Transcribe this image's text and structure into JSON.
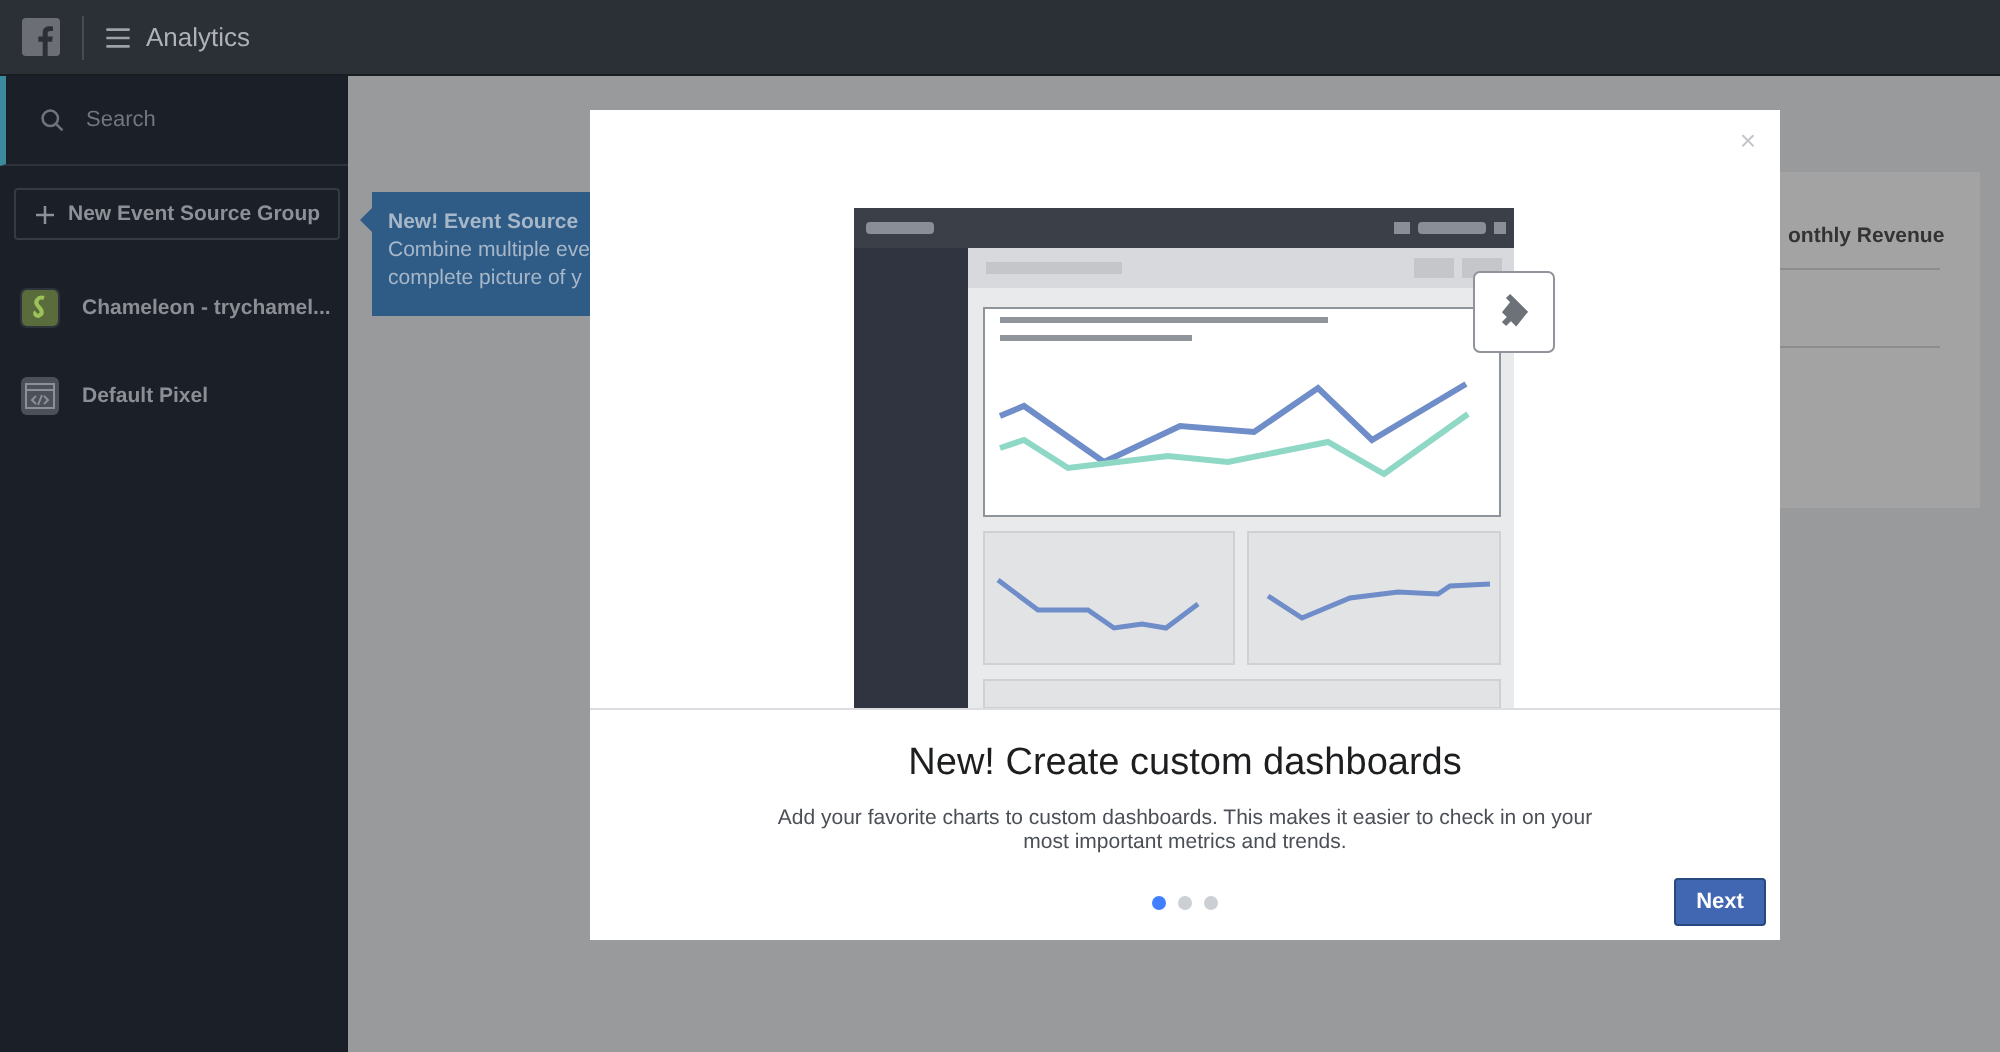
{
  "topbar": {
    "title": "Analytics"
  },
  "sidebar": {
    "search_placeholder": "Search",
    "new_group_button": "New Event Source Group",
    "items": [
      {
        "label": "Chameleon - trychamel...",
        "kind": "app"
      },
      {
        "label": "Default Pixel",
        "kind": "pixel"
      }
    ]
  },
  "tooltip": {
    "title": "New! Event Source",
    "lines": [
      "Combine multiple eve",
      "complete picture of y"
    ]
  },
  "background_card": {
    "title": "onthly Revenue"
  },
  "modal": {
    "title": "New! Create custom dashboards",
    "description": "Add your favorite charts to custom dashboards. This makes it easier to check in on your most important metrics and trends.",
    "close": "×",
    "pages": [
      {
        "selected": true
      },
      {
        "selected": false
      },
      {
        "selected": false
      }
    ],
    "next_button": "Next"
  }
}
